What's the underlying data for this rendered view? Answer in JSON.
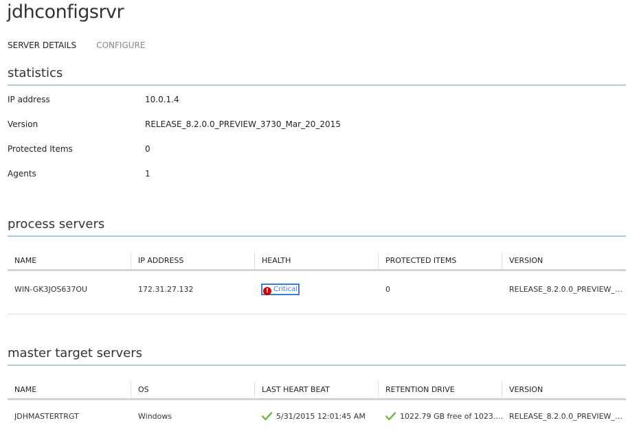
{
  "page": {
    "title": "jdhconfigsrvr"
  },
  "tabs": [
    {
      "label": "SERVER DETAILS",
      "active": true
    },
    {
      "label": "CONFIGURE",
      "active": false
    }
  ],
  "statistics": {
    "heading": "statistics",
    "rows": [
      {
        "label": "IP address",
        "value": "10.0.1.4"
      },
      {
        "label": "Version",
        "value": "RELEASE_8.2.0.0_PREVIEW_3730_Mar_20_2015"
      },
      {
        "label": "Protected Items",
        "value": "0"
      },
      {
        "label": "Agents",
        "value": "1"
      }
    ]
  },
  "process_servers": {
    "heading": "process servers",
    "columns": [
      "NAME",
      "IP ADDRESS",
      "HEALTH",
      "PROTECTED ITEMS",
      "VERSION"
    ],
    "rows": [
      {
        "name": "WIN-GK3JOS637OU",
        "ip_address": "172.31.27.132",
        "health": "Critical",
        "health_icon": "critical-error-icon",
        "protected_items": "0",
        "version": "RELEASE_8.2.0.0_PREVIEW_3730_..."
      }
    ]
  },
  "master_target_servers": {
    "heading": "master target servers",
    "columns": [
      "NAME",
      "OS",
      "LAST HEART BEAT",
      "RETENTION DRIVE",
      "VERSION"
    ],
    "rows": [
      {
        "name": "JDHMASTERTRGT",
        "os": "Windows",
        "last_heart_beat": "5/31/2015 12:01:45 AM",
        "last_heart_beat_icon": "checkmark-icon",
        "retention_drive": "1022.79 GB free of 1023.00 GB",
        "retention_drive_icon": "checkmark-icon",
        "version": "RELEASE_8.2.0.0_PREVIEW_3730_..."
      }
    ]
  },
  "colors": {
    "accent_rule": "#a9c9e6",
    "link_blue": "#3a7bd5",
    "critical_red": "#cc0000",
    "ok_green": "#7ab648"
  }
}
